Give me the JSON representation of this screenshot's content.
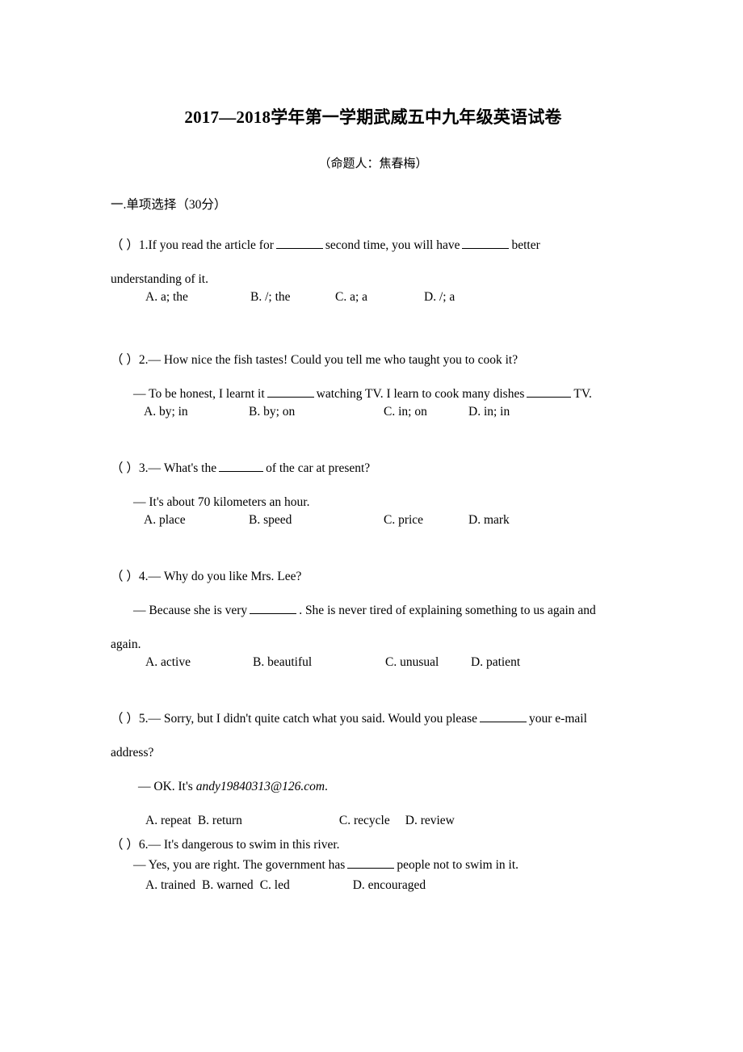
{
  "document": {
    "title": "2017—2018学年第一学期武威五中九年级英语试卷",
    "subtitle": "（命题人：焦春梅）",
    "section_heading": "一.单项选择（30分）"
  },
  "questions": [
    {
      "marker": "（  ）1.",
      "stem_part1": "If you read the article for",
      "stem_part2": "second time, you will have",
      "stem_part3": "better",
      "continuation": "understanding of it.",
      "options": [
        "A. a; the",
        "B. /; the",
        "C. a; a",
        "D. /; a"
      ]
    },
    {
      "marker": "（  ）2.",
      "stem": "— How nice the fish tastes! Could you tell me who taught you to cook it?",
      "answer_part1": "— To be honest, I learnt it",
      "answer_part2": "watching TV. I learn to cook many dishes",
      "answer_part3": "TV.",
      "options": [
        "A. by; in",
        "B. by; on",
        "C. in; on",
        "D. in; in"
      ]
    },
    {
      "marker": "（  ）3.",
      "stem_part1": "— What's the",
      "stem_part2": "of the car at present?",
      "answer": "— It's about 70 kilometers an hour.",
      "options": [
        "A. place",
        "B. speed",
        "C. price",
        "D. mark"
      ]
    },
    {
      "marker": "（  ）4.",
      "stem": "— Why do you like Mrs. Lee?",
      "answer_part1": "— Because she is very",
      "answer_part2": ". She is never tired of explaining something to us again and",
      "continuation": "again.",
      "options": [
        "A. active",
        "B. beautiful",
        "C. unusual",
        "D. patient"
      ]
    },
    {
      "marker": "（  ）5.",
      "stem_part1": "— Sorry, but I didn't quite catch what you said. Would you please",
      "stem_part2": "your e-mail",
      "continuation": "address?",
      "answer_prefix": "— OK. It's ",
      "answer_email": "andy19840313@126.com",
      "answer_suffix": ".",
      "options": [
        "A. repeat",
        "B. return",
        "C. recycle",
        "D. review"
      ]
    },
    {
      "marker": "（  ）6.",
      "stem": "— It's dangerous to swim in this river.",
      "answer_part1": "— Yes, you are right. The government has",
      "answer_part2": "people not to swim in it.",
      "options": [
        "A. trained",
        "B. warned",
        "C. led",
        "D. encouraged"
      ]
    }
  ]
}
